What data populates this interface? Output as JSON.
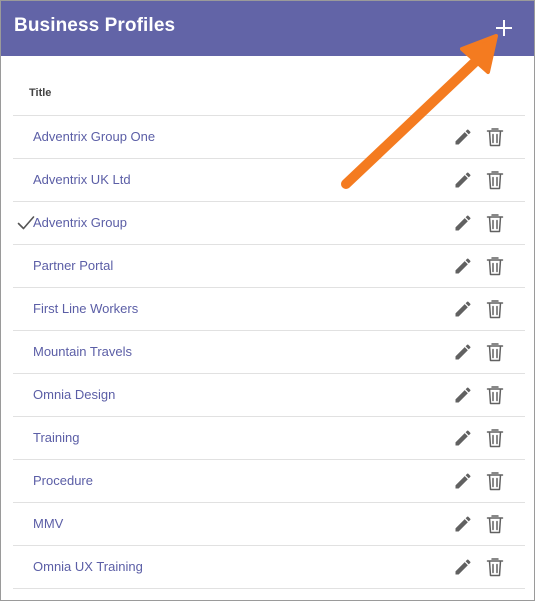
{
  "header": {
    "title": "Business Profiles",
    "add_icon": "plus-icon"
  },
  "table": {
    "column_title": "Title",
    "rows": [
      {
        "title": "Adventrix Group One",
        "selected": false
      },
      {
        "title": "Adventrix UK Ltd",
        "selected": false
      },
      {
        "title": "Adventrix Group",
        "selected": true
      },
      {
        "title": "Partner Portal",
        "selected": false
      },
      {
        "title": "First Line Workers",
        "selected": false
      },
      {
        "title": "Mountain Travels",
        "selected": false
      },
      {
        "title": "Omnia Design",
        "selected": false
      },
      {
        "title": "Training",
        "selected": false
      },
      {
        "title": "Procedure",
        "selected": false
      },
      {
        "title": "MMV",
        "selected": false
      },
      {
        "title": "Omnia UX Training",
        "selected": false
      }
    ],
    "row_icons": [
      "pencil-icon",
      "trash-icon"
    ]
  },
  "colors": {
    "header_bg": "#6264a7",
    "link_text": "#5b5ea6",
    "annotation_arrow": "#f47b20"
  }
}
